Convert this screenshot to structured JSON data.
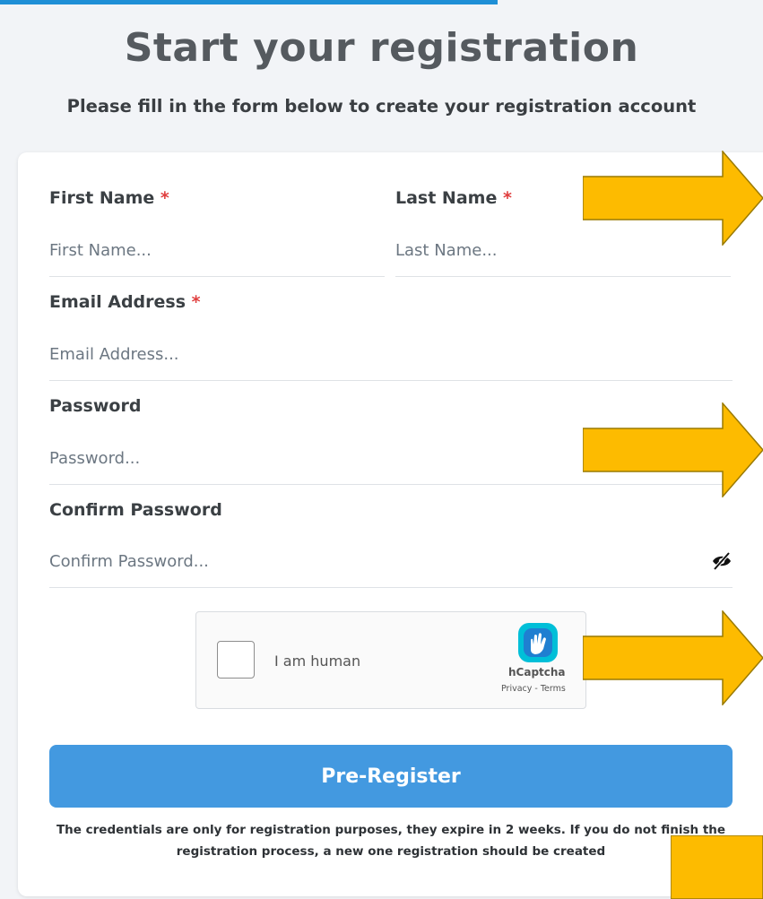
{
  "header": {
    "title": "Start your registration",
    "subtitle": "Please fill in the form below to create your registration account",
    "accent_color": "#1f8fd6"
  },
  "form": {
    "first_name": {
      "label": "First Name",
      "required_mark": "*",
      "placeholder": "First Name..."
    },
    "last_name": {
      "label": "Last Name",
      "required_mark": "*",
      "placeholder": "Last Name..."
    },
    "email": {
      "label": "Email Address",
      "required_mark": "*",
      "placeholder": "Email Address..."
    },
    "password": {
      "label": "Password",
      "placeholder": "Password..."
    },
    "confirm_password": {
      "label": "Confirm Password",
      "placeholder": "Confirm Password...",
      "toggle_icon": "eye-slash-icon"
    },
    "captcha": {
      "checkbox_label": "I am human",
      "brand": "hCaptcha",
      "links": "Privacy - Terms"
    },
    "submit_label": "Pre-Register",
    "submit_color": "#4399e0",
    "note": "The credentials are only for registration purposes, they expire in 2 weeks. If you do not finish the registration process, a new one registration should be created"
  },
  "annotations": {
    "arrow_color": "#fdbb00",
    "arrow_icon": "arrow-right-icon"
  }
}
